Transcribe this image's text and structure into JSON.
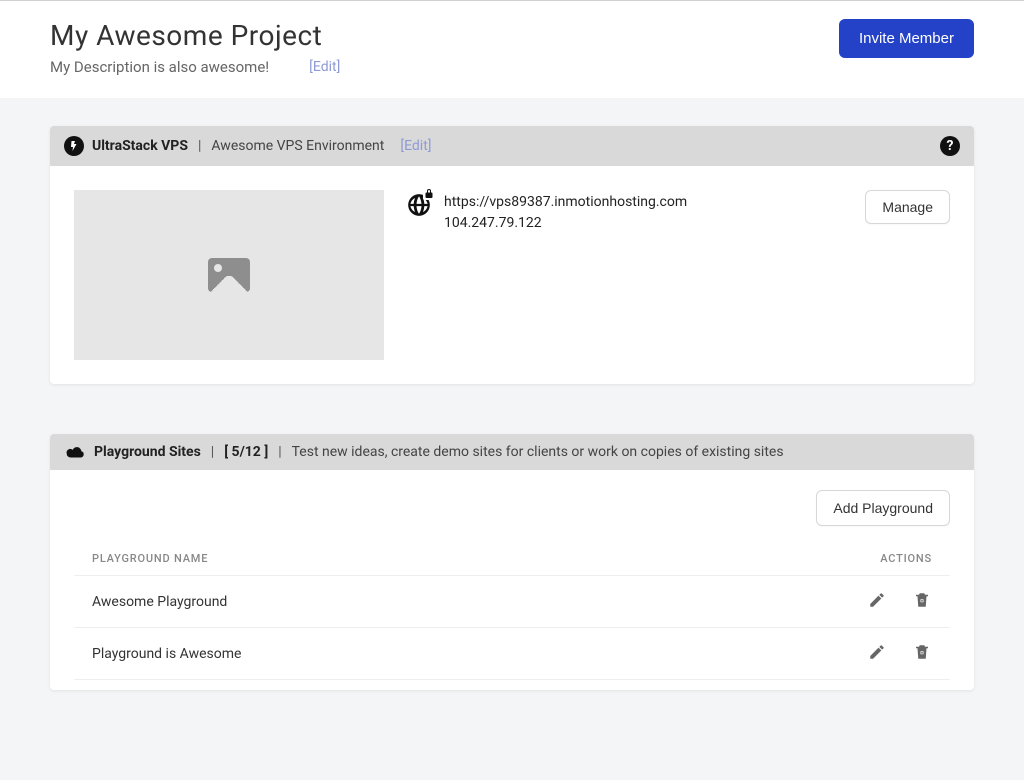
{
  "header": {
    "title": "My Awesome Project",
    "description": "My Description is also awesome!",
    "edit_label": "[Edit]",
    "invite_label": "Invite Member"
  },
  "vps_card": {
    "icon": "bolt-icon",
    "title": "UltraStack VPS",
    "env_name": "Awesome VPS Environment",
    "edit_label": "[Edit]",
    "url": "https://vps89387.inmotionhosting.com",
    "ip": "104.247.79.122",
    "manage_label": "Manage"
  },
  "playground_card": {
    "icon": "cloud-icon",
    "title": "Playground Sites",
    "count_label": "[ 5/12 ]",
    "description": "Test new ideas, create demo sites for clients or work on copies of existing sites",
    "add_label": "Add Playground",
    "columns": {
      "name": "PLAYGROUND NAME",
      "actions": "ACTIONS"
    },
    "rows": [
      {
        "name": "Awesome Playground"
      },
      {
        "name": "Playground is Awesome"
      }
    ]
  }
}
